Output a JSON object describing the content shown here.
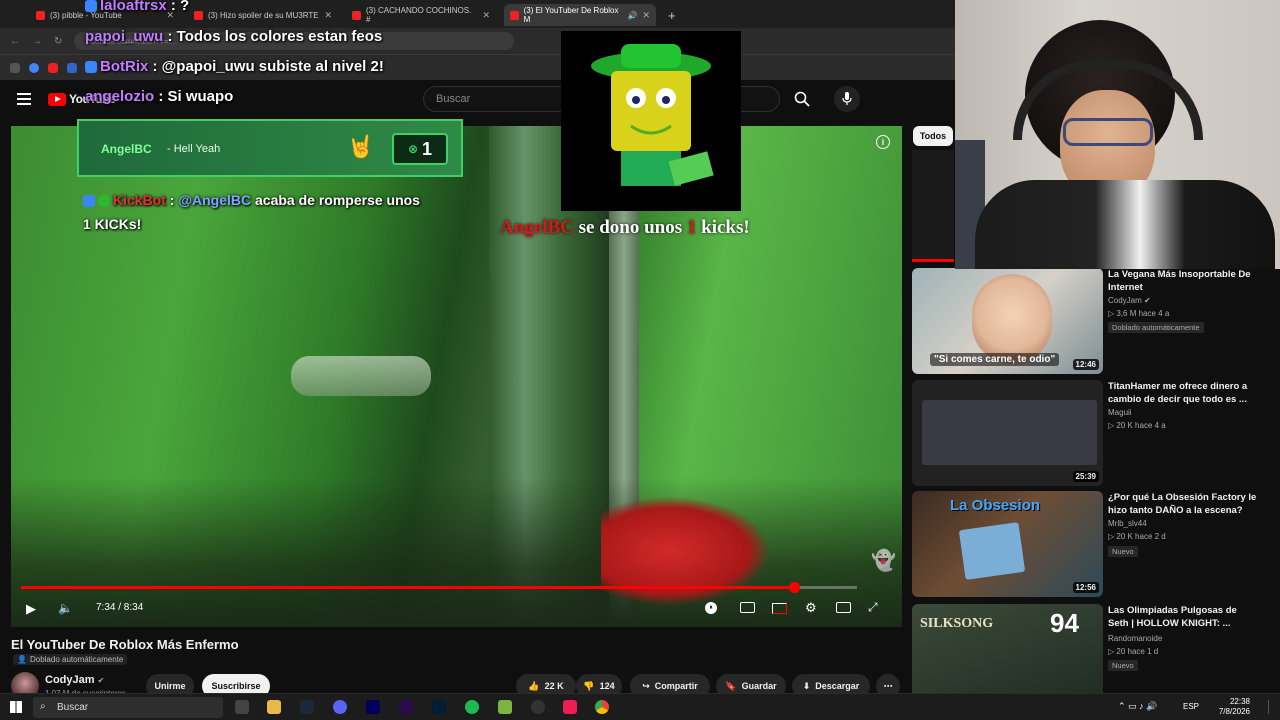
{
  "browser": {
    "tabs": [
      {
        "label": "(3) pibble - YouTube"
      },
      {
        "label": "(3) Hizo spoiler de su MU3RTE"
      },
      {
        "label": "(3) CACHANDO COCHINOS. #"
      },
      {
        "label": "(3) El YouTuber De Roblox M"
      }
    ],
    "url": "youtube.com/watch?v=..."
  },
  "youtube": {
    "logo": "YouTube",
    "search_placeholder": "Buscar"
  },
  "overlay": {
    "donor_name": "AngelBC",
    "donor_msg": "- Hell Yeah",
    "donor_count": "1",
    "alert_name": "AngelBC",
    "alert_mid": " se dono unos ",
    "alert_num": "1",
    "alert_end": " kicks!",
    "chat": [
      {
        "user": "laloaftrsx",
        "text": " : ?"
      },
      {
        "user": "papoi_uwu",
        "text": " : Todos los colores estan feos"
      },
      {
        "user": "BotRix",
        "text": " : @papoi_uwu subiste al nivel 2!"
      },
      {
        "user": "angelozio",
        "text": " : Si wuapo"
      }
    ],
    "kickbot_user": "KickBot",
    "kickbot_mention": "@AngelBC",
    "kickbot_line1": " acaba de romperse unos",
    "kickbot_line2": "1 KICKs!"
  },
  "player": {
    "time": "7:34 / 8:34",
    "progress": 0.925,
    "title": "El YouTuber De Roblox Más Enfermo",
    "dub_label": "Doblado automáticamente",
    "channel": "CodyJam",
    "subscribers": "1,07 M de suscriptores",
    "join_label": "Unirme",
    "subscribe_label": "Suscribirse",
    "likes": "22 K",
    "dislikes": "124",
    "share_label": "Compartir",
    "save_label": "Guardar",
    "download_label": "Descargar"
  },
  "sidebar": {
    "filter": "Todos",
    "videos": [
      {
        "title": "La Vegana Más Insoportable De Internet",
        "channel": "CodyJam",
        "meta": "3,6 M  hace 4 a",
        "badge": "Doblado automáticamente",
        "duration": "12:46",
        "thumb_text": "\"Si comes carne, te odio\""
      },
      {
        "title": "TitanHamer me ofrece dinero a cambio de decir que todo es ...",
        "channel": "Maguii",
        "meta": "20 K  hace 4 a",
        "badge": "",
        "duration": "25:39",
        "thumb_text": ""
      },
      {
        "title": "¿Por qué La Obsesión Factory le hizo tanto DAÑO a la escena?",
        "channel": "Mrlb_slv44",
        "meta": "20 K  hace 2 d",
        "badge": "Nuevo",
        "duration": "12:56",
        "thumb_text": "La Obsesion"
      },
      {
        "title": "Las Olimpiadas Pulgosas de Seth | HOLLOW KNIGHT: ...",
        "channel": "Randomanoide",
        "meta": "20  hace 1 d",
        "badge": "Nuevo",
        "duration": "",
        "thumb_text": "SILKSONG"
      }
    ]
  },
  "taskbar": {
    "search": "Buscar",
    "lang": "ESP",
    "time": "22:38",
    "date": "7/8/2026"
  },
  "colors": {
    "accent": "#ff0000",
    "kick_green": "#3fd06a"
  }
}
